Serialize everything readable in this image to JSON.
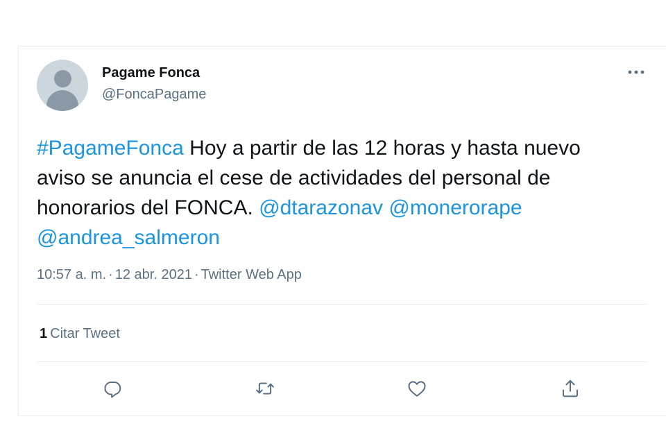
{
  "tweet": {
    "display_name": "Pagame Fonca",
    "handle": "@FoncaPagame",
    "text": {
      "hashtag": "#PagameFonca",
      "body": " Hoy a partir de las 12 horas y hasta nuevo aviso se anuncia el cese de actividades del personal de honorarios del FONCA. ",
      "mention_1": "@dtarazonav",
      "mention_2": "@monerorape",
      "mention_3": "@andrea_salmeron"
    },
    "time": "10:57 a. m.",
    "separator": "·",
    "date": "12 abr. 2021",
    "source": "Twitter Web App",
    "quote_count": "1",
    "quote_label": "Citar Tweet"
  },
  "icons": {
    "more": "more-horizontal-icon",
    "reply": "reply-icon",
    "retweet": "retweet-icon",
    "like": "heart-icon",
    "share": "share-icon"
  },
  "colors": {
    "link": "#1b95e0",
    "secondary_text": "#5b7083",
    "primary_text": "#0f1419",
    "divider": "#ebeef0",
    "icon": "#5b7083"
  }
}
